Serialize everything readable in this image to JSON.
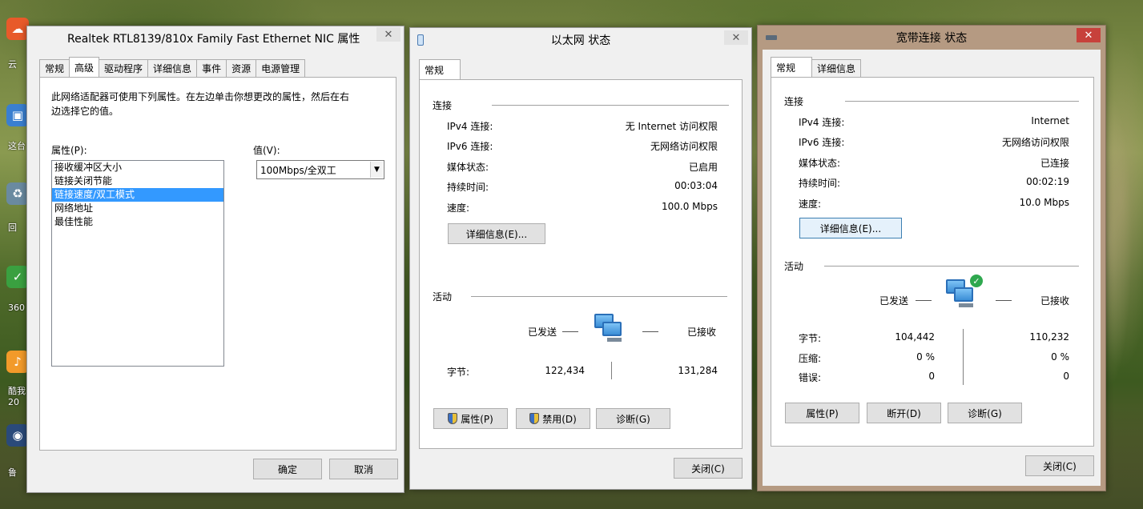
{
  "win1": {
    "title": "Realtek RTL8139/810x Family Fast Ethernet NIC 属性",
    "close": "✕",
    "tabs": [
      "常规",
      "高级",
      "驱动程序",
      "详细信息",
      "事件",
      "资源",
      "电源管理"
    ],
    "active_tab": "高级",
    "description": "此网络适配器可使用下列属性。在左边单击你想更改的属性，然后在右边选择它的值。",
    "property_label": "属性(P):",
    "value_label": "值(V):",
    "properties": [
      "接收缓冲区大小",
      "链接关闭节能",
      "链接速度/双工模式",
      "网络地址",
      "最佳性能"
    ],
    "selected_property": "链接速度/双工模式",
    "value": "100Mbps/全双工",
    "ok": "确定",
    "cancel": "取消"
  },
  "win2": {
    "title": "以太网 状态",
    "close": "✕",
    "tab": "常规",
    "connection_label": "连接",
    "rows": [
      {
        "key": "IPv4 连接:",
        "value": "无 Internet 访问权限"
      },
      {
        "key": "IPv6 连接:",
        "value": "无网络访问权限"
      },
      {
        "key": "媒体状态:",
        "value": "已启用"
      },
      {
        "key": "持续时间:",
        "value": "00:03:04"
      },
      {
        "key": "速度:",
        "value": "100.0 Mbps"
      }
    ],
    "details_button": "详细信息(E)...",
    "activity_label": "活动",
    "sent_label": "已发送",
    "received_label": "已接收",
    "bytes_label": "字节:",
    "bytes_sent": "122,434",
    "bytes_received": "131,284",
    "properties_button": "属性(P)",
    "disable_button": "禁用(D)",
    "diagnose_button": "诊断(G)",
    "close_button": "关闭(C)"
  },
  "win3": {
    "title": "宽带连接 状态",
    "close": "✕",
    "tabs": [
      "常规",
      "详细信息"
    ],
    "active_tab": "常规",
    "connection_label": "连接",
    "rows": [
      {
        "key": "IPv4 连接:",
        "value": "Internet"
      },
      {
        "key": "IPv6 连接:",
        "value": "无网络访问权限"
      },
      {
        "key": "媒体状态:",
        "value": "已连接"
      },
      {
        "key": "持续时间:",
        "value": "00:02:19"
      },
      {
        "key": "速度:",
        "value": "10.0 Mbps"
      }
    ],
    "details_button": "详细信息(E)...",
    "activity_label": "活动",
    "sent_label": "已发送",
    "received_label": "已接收",
    "stats": [
      {
        "key": "字节:",
        "sent": "104,442",
        "received": "110,232"
      },
      {
        "key": "压缩:",
        "sent": "0 %",
        "received": "0 %"
      },
      {
        "key": "错误:",
        "sent": "0",
        "received": "0"
      }
    ],
    "properties_button": "属性(P)",
    "disconnect_button": "断开(D)",
    "diagnose_button": "诊断(G)",
    "close_button": "关闭(C)"
  },
  "desktop": {
    "icon_labels": [
      "云",
      "这台",
      "回",
      "360",
      "酷我",
      "20",
      "鲁"
    ]
  },
  "colors": {
    "selection": "#3399ff",
    "close_red": "#c7413b",
    "win3_frame": "#b59a82"
  }
}
